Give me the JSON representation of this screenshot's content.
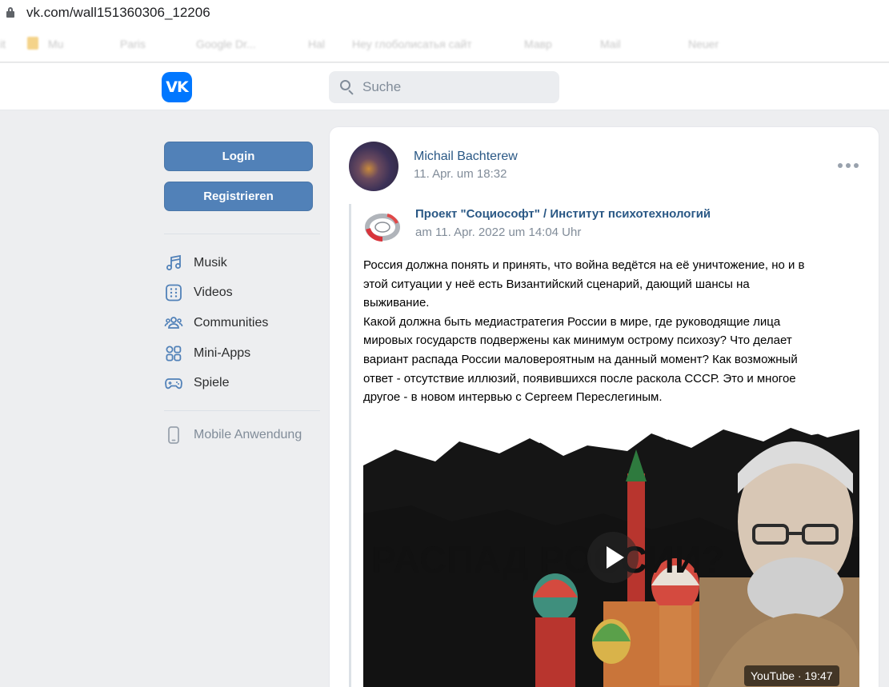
{
  "browser": {
    "url": "vk.com/wall151360306_12206",
    "bookmarks": [
      "it",
      "Mu",
      "Paris",
      "Google Dr...",
      "Hal",
      "Неу глоболисатья сайт",
      "Мавр",
      "Mail",
      "Neuer"
    ]
  },
  "header": {
    "logo_text": "VK",
    "search_placeholder": "Suche"
  },
  "sidebar": {
    "login_label": "Login",
    "register_label": "Registrieren",
    "items": [
      {
        "label": "Musik",
        "icon": "music-note-icon"
      },
      {
        "label": "Videos",
        "icon": "videos-icon"
      },
      {
        "label": "Communities",
        "icon": "communities-icon"
      },
      {
        "label": "Mini-Apps",
        "icon": "mini-apps-icon"
      },
      {
        "label": "Spiele",
        "icon": "gamepad-icon"
      }
    ],
    "mobile_label": "Mobile Anwendung"
  },
  "post": {
    "author": "Michail Bachterew",
    "date": "11. Apr. um 18:32",
    "repost": {
      "source_name": "Проект \"Социософт\" / Институт психотехнологий",
      "source_date": "am 11. Apr. 2022 um 14:04 Uhr"
    },
    "text_lines": [
      "Россия должна понять и принять, что война ведётся на её уничтожение, но и в",
      "этой ситуации у неё есть Византийский сценарий, дающий шансы на",
      "выживание.",
      "Какой должна быть медиастратегия России в мире, где руководящие лица",
      "мировых государств подвержены как минимум острому психозу? Что делает",
      "вариант распада России маловероятным на данный момент? Как возможный",
      "ответ - отсутствие иллюзий, появившихся после раскола СССР. Это и многое",
      "другое - в новом интервью с Сергеем Переслегиным."
    ],
    "video": {
      "title": "РАСПАД РОССИИ?",
      "badge": "YouTube · 19:47"
    }
  },
  "colors": {
    "vk_blue": "#0077ff",
    "button_blue": "#5181b8",
    "link": "#2a5885",
    "muted": "#818c99",
    "page_bg": "#edeef0"
  }
}
